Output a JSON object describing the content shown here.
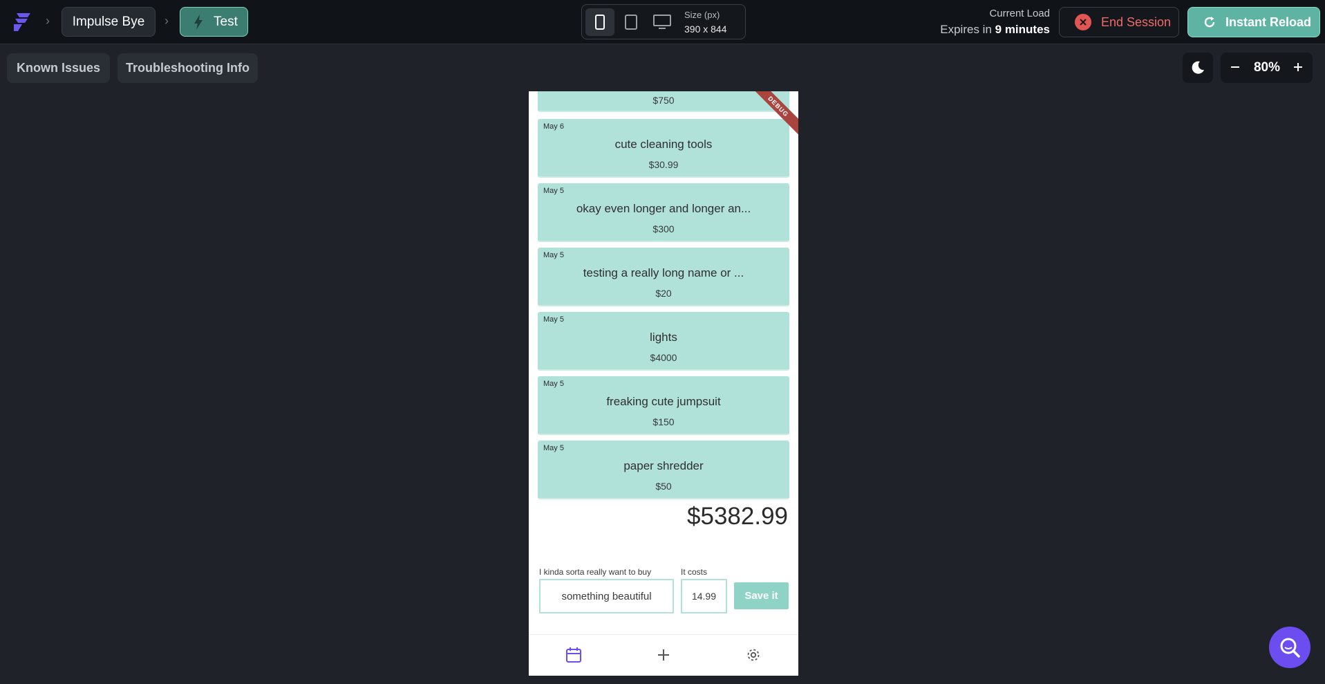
{
  "header": {
    "project_name": "Impulse Bye",
    "branch_name": "Test",
    "size_label": "Size (px)",
    "size_value": "390 x 844",
    "load_title": "Current Load",
    "expires_prefix": "Expires in",
    "expires_value": "9 minutes",
    "end_session_label": "End Session",
    "instant_reload_label": "Instant Reload"
  },
  "toolbar": {
    "known_issues_label": "Known Issues",
    "troubleshooting_label": "Troubleshooting Info",
    "zoom_value": "80%"
  },
  "app": {
    "debug_banner": "DEBUG",
    "partial_card_price": "$750",
    "items": [
      {
        "date": "May 6",
        "name": "cute cleaning tools",
        "price": "$30.99"
      },
      {
        "date": "May 5",
        "name": "okay even longer and longer an...",
        "price": "$300"
      },
      {
        "date": "May 5",
        "name": "testing a really long name or ...",
        "price": "$20"
      },
      {
        "date": "May 5",
        "name": "lights",
        "price": "$4000"
      },
      {
        "date": "May 5",
        "name": "freaking cute jumpsuit",
        "price": "$150"
      },
      {
        "date": "May 5",
        "name": "paper shredder",
        "price": "$50"
      }
    ],
    "total": "$5382.99",
    "form": {
      "item_label": "I kinda sorta really want to buy",
      "item_value": "something beautiful",
      "cost_label": "It costs",
      "cost_value": "14.99",
      "save_label": "Save it"
    }
  },
  "colors": {
    "accent": "#5fb3a3",
    "card": "#b0e2da",
    "danger": "#e25555",
    "fab": "#6c4ef0",
    "nav_active": "#6c4ef0"
  }
}
